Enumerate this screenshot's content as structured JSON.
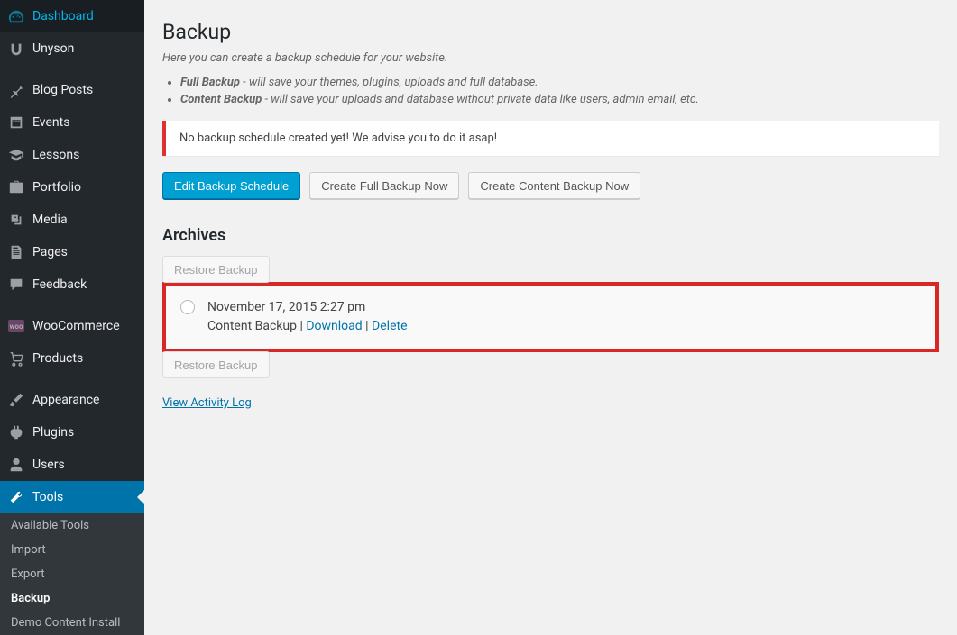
{
  "sidebar": {
    "items": [
      {
        "label": "Dashboard"
      },
      {
        "label": "Unyson"
      },
      {
        "label": "Blog Posts"
      },
      {
        "label": "Events"
      },
      {
        "label": "Lessons"
      },
      {
        "label": "Portfolio"
      },
      {
        "label": "Media"
      },
      {
        "label": "Pages"
      },
      {
        "label": "Feedback"
      },
      {
        "label": "WooCommerce"
      },
      {
        "label": "Products"
      },
      {
        "label": "Appearance"
      },
      {
        "label": "Plugins"
      },
      {
        "label": "Users"
      },
      {
        "label": "Tools"
      }
    ],
    "sub": [
      {
        "label": "Available Tools"
      },
      {
        "label": "Import"
      },
      {
        "label": "Export"
      },
      {
        "label": "Backup"
      },
      {
        "label": "Demo Content Install"
      }
    ]
  },
  "page": {
    "title": "Backup",
    "description": "Here you can create a backup schedule for your website.",
    "bullets": {
      "full_label": "Full Backup",
      "full_text": " - will save your themes, plugins, uploads and full database.",
      "content_label": "Content Backup",
      "content_text": " - will save your uploads and database without private data like users, admin email, etc."
    },
    "notice": "No backup schedule created yet! We advise you to do it asap!",
    "buttons": {
      "edit": "Edit Backup Schedule",
      "full": "Create Full Backup Now",
      "content": "Create Content Backup Now"
    },
    "archives_title": "Archives",
    "restore": "Restore Backup",
    "archive": {
      "date": "November 17, 2015 2:27 pm",
      "type": "Content Backup",
      "sep1": " | ",
      "download": "Download",
      "sep2": " | ",
      "delete": "Delete"
    },
    "activity_log": "View Activity Log"
  }
}
